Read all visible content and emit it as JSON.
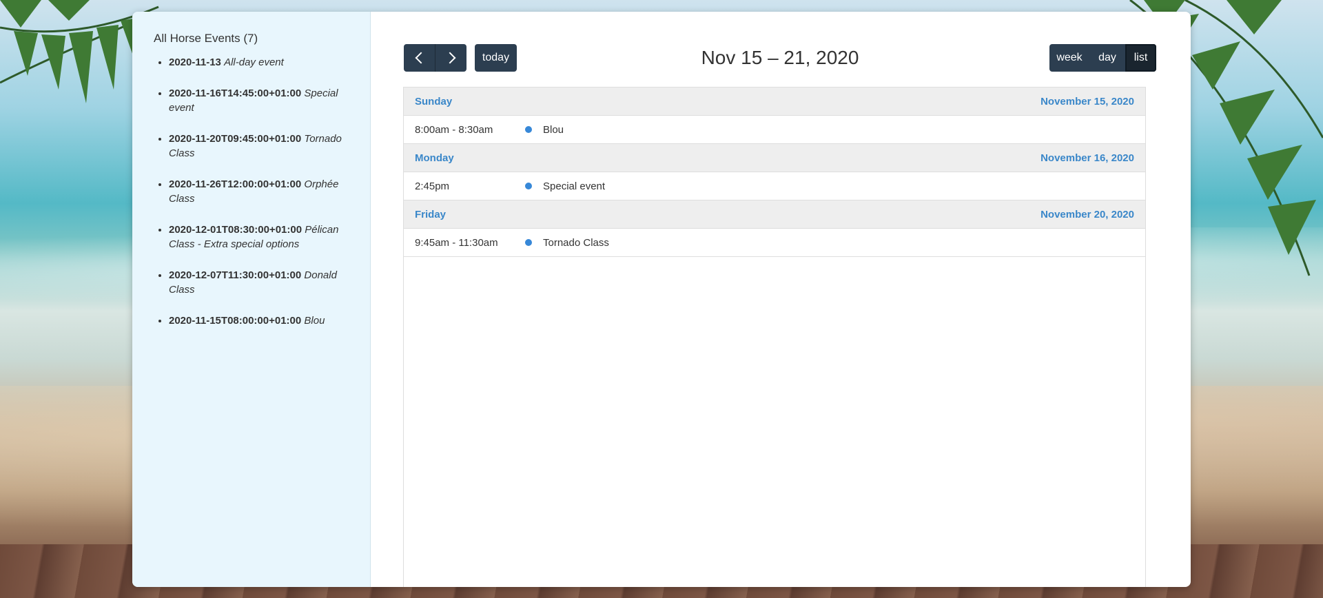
{
  "sidebar": {
    "title": "All Horse Events (7)",
    "events": [
      {
        "datetime": "2020-11-13",
        "title": "All-day event"
      },
      {
        "datetime": "2020-11-16T14:45:00+01:00",
        "title": "Special event"
      },
      {
        "datetime": "2020-11-20T09:45:00+01:00",
        "title": "Tornado Class"
      },
      {
        "datetime": "2020-11-26T12:00:00+01:00",
        "title": "Orphée Class"
      },
      {
        "datetime": "2020-12-01T08:30:00+01:00",
        "title": "Pélican Class - Extra special options"
      },
      {
        "datetime": "2020-12-07T11:30:00+01:00",
        "title": "Donald Class"
      },
      {
        "datetime": "2020-11-15T08:00:00+01:00",
        "title": "Blou"
      }
    ]
  },
  "toolbar": {
    "prev_icon": "chevron-left-icon",
    "next_icon": "chevron-right-icon",
    "today_label": "today",
    "title": "Nov 15 – 21, 2020",
    "views": {
      "week": "week",
      "day": "day",
      "list": "list"
    },
    "active_view": "list"
  },
  "colors": {
    "button": "#2c3e50",
    "day_header_text": "#3a87c9",
    "event_dot": "#3788d8",
    "sidebar_bg": "#e8f6fd"
  },
  "days": [
    {
      "day_name": "Sunday",
      "date": "November 15, 2020",
      "events": [
        {
          "time": "8:00am - 8:30am",
          "title": "Blou"
        }
      ]
    },
    {
      "day_name": "Monday",
      "date": "November 16, 2020",
      "events": [
        {
          "time": "2:45pm",
          "title": "Special event"
        }
      ]
    },
    {
      "day_name": "Friday",
      "date": "November 20, 2020",
      "events": [
        {
          "time": "9:45am - 11:30am",
          "title": "Tornado Class"
        }
      ]
    }
  ]
}
